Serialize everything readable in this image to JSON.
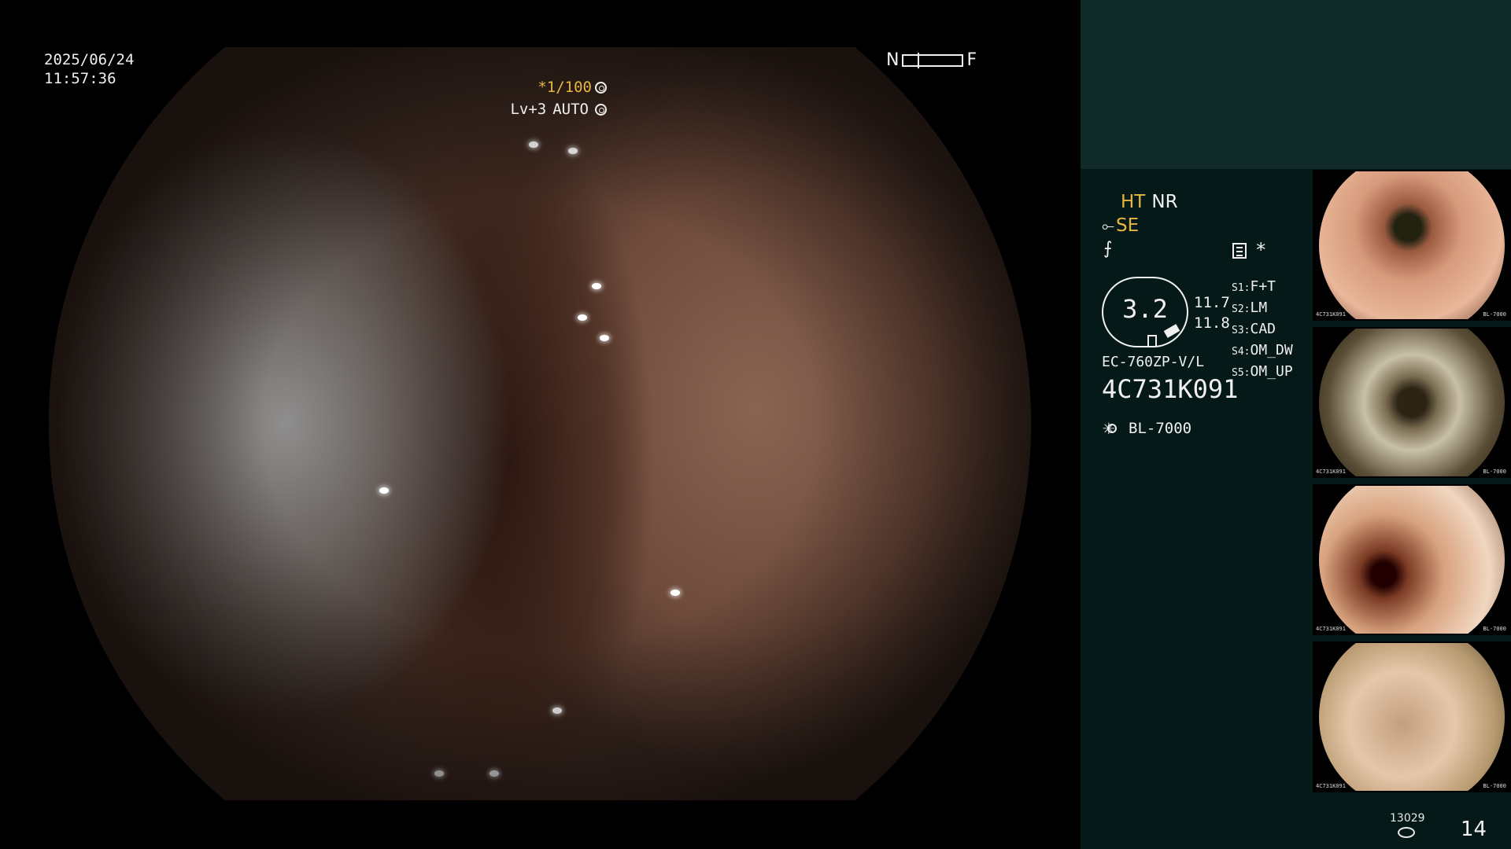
{
  "overlay": {
    "date": "2025/06/24",
    "time": "11:57:36",
    "near_label": "N",
    "far_label": "F",
    "shutter": "*1/100",
    "level": "Lv+3",
    "mode": "AUTO"
  },
  "panel": {
    "ht": "HT",
    "nr": "NR",
    "se": "SE",
    "zoom_symbol": "⨍",
    "asterisk": "*",
    "gauge_value": "3.2",
    "value_a": "11.7",
    "value_b": "11.8",
    "scope_model": "EC-760ZP-V/L",
    "serial": "4C731K091",
    "light_source": "BL-7000",
    "slots": [
      {
        "key": "S1:",
        "value": "F+T"
      },
      {
        "key": "S2:",
        "value": "LM"
      },
      {
        "key": "S3:",
        "value": "CAD"
      },
      {
        "key": "S4:",
        "value": "OM_DW"
      },
      {
        "key": "S5:",
        "value": "OM_UP"
      }
    ],
    "thumbnail_serial": "4C731K091",
    "thumbnail_light": "BL-7000",
    "image_count": "13029",
    "frame_count": "14"
  },
  "colors": {
    "accent_orange": "#e8b640",
    "panel_bg": "#051a18",
    "panel_top_bg": "#0f2a28"
  },
  "icons": [
    "sun-icon",
    "capture-icon",
    "disk-icon",
    "shutter-icon",
    "auto-iris-icon"
  ]
}
